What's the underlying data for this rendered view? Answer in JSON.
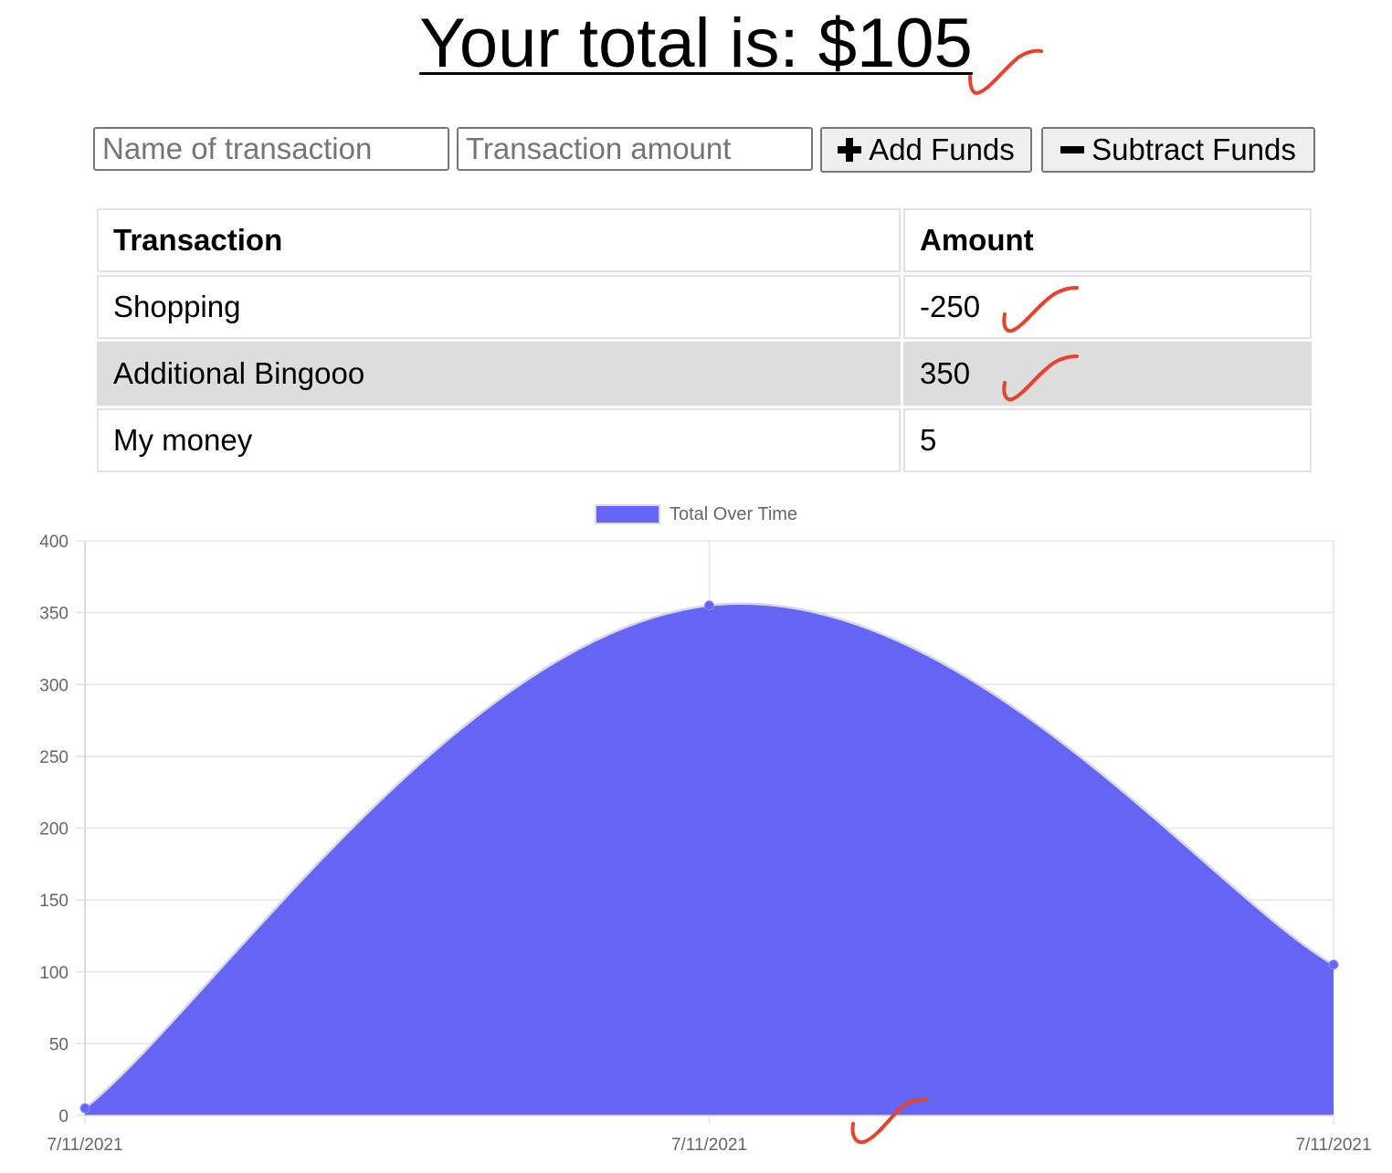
{
  "header": {
    "title_prefix": "Your total is: $",
    "total": "105"
  },
  "form": {
    "name_placeholder": "Name of transaction",
    "amount_placeholder": "Transaction amount",
    "add_label": "Add Funds",
    "subtract_label": "Subtract Funds",
    "add_icon": "plus-icon",
    "subtract_icon": "minus-icon"
  },
  "table": {
    "headers": [
      "Transaction",
      "Amount"
    ],
    "rows": [
      {
        "name": "Shopping",
        "amount": "-250"
      },
      {
        "name": "Additional Bingooo",
        "amount": "350"
      },
      {
        "name": "My money",
        "amount": "5"
      }
    ]
  },
  "annotations": {
    "icon": "check-mark-icon",
    "color": "#e8432a"
  },
  "chart_data": {
    "type": "area",
    "title": "",
    "legend": "top-center",
    "x": [
      "7/11/2021",
      "7/11/2021",
      "7/11/2021"
    ],
    "series": [
      {
        "name": "Total Over Time",
        "values": [
          5,
          355,
          105
        ],
        "color": "#6464f5"
      }
    ],
    "ylim": [
      0,
      400
    ],
    "yticks": [
      0,
      50,
      100,
      150,
      200,
      250,
      300,
      350,
      400
    ],
    "grid": true
  }
}
